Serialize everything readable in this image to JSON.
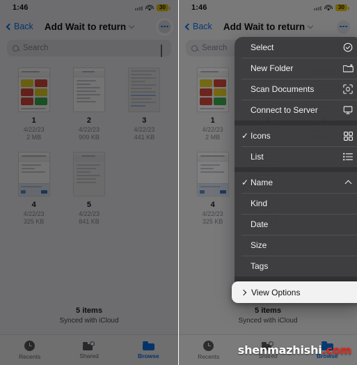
{
  "status": {
    "time": "1:46",
    "battery": "30",
    "wifi_icon": "wifi-icon",
    "signal_icon": "cellular-signal-icon"
  },
  "nav": {
    "back_label": "Back",
    "title": "Add Wait to return",
    "chevron_icon": "chevron-down-icon",
    "more_icon": "ellipsis-circle-icon"
  },
  "search": {
    "placeholder": "Search",
    "search_icon": "search-icon",
    "mic_icon": "microphone-icon"
  },
  "files": [
    {
      "name": "1",
      "date": "4/22/23",
      "size": "2 MB"
    },
    {
      "name": "2",
      "date": "4/22/23",
      "size": "909 KB"
    },
    {
      "name": "3",
      "date": "4/22/23",
      "size": "441 KB"
    },
    {
      "name": "4",
      "date": "4/22/23",
      "size": "325 KB"
    },
    {
      "name": "5",
      "date": "4/22/23",
      "size": "841 KB"
    }
  ],
  "footer": {
    "count": "5 items",
    "sync": "Synced with iCloud"
  },
  "tabs": [
    {
      "label": "Recents",
      "icon": "clock-icon",
      "active": false
    },
    {
      "label": "Shared",
      "icon": "shared-folder-icon",
      "active": false
    },
    {
      "label": "Browse",
      "icon": "folder-icon",
      "active": true
    }
  ],
  "context_menu": {
    "groups": [
      {
        "items": [
          {
            "label": "Select",
            "icon": "check-circle-icon",
            "checked": false
          },
          {
            "label": "New Folder",
            "icon": "new-folder-icon",
            "checked": false
          },
          {
            "label": "Scan Documents",
            "icon": "scan-documents-icon",
            "checked": false
          },
          {
            "label": "Connect to Server",
            "icon": "monitor-icon",
            "checked": false
          }
        ]
      },
      {
        "items": [
          {
            "label": "Icons",
            "icon": "grid-icon",
            "checked": true
          },
          {
            "label": "List",
            "icon": "list-icon",
            "checked": false
          }
        ]
      },
      {
        "items": [
          {
            "label": "Name",
            "icon": "chevron-up-icon",
            "checked": true
          },
          {
            "label": "Kind",
            "icon": "",
            "checked": false
          },
          {
            "label": "Date",
            "icon": "",
            "checked": false
          },
          {
            "label": "Size",
            "icon": "",
            "checked": false
          },
          {
            "label": "Tags",
            "icon": "",
            "checked": false
          }
        ]
      },
      {
        "items": [
          {
            "label": "View Options",
            "icon": "chevron-right-icon",
            "checked": false,
            "highlighted": true
          }
        ]
      }
    ]
  },
  "watermark": {
    "name": "shenmazhishi",
    "tld": ".com"
  },
  "colors": {
    "accent_blue": "#0a74e8",
    "battery_yellow": "#e8c511",
    "menu_bg": "#3c3c3e",
    "highlight_bg": "#f2f2f2",
    "watermark_red": "#e02b20"
  }
}
